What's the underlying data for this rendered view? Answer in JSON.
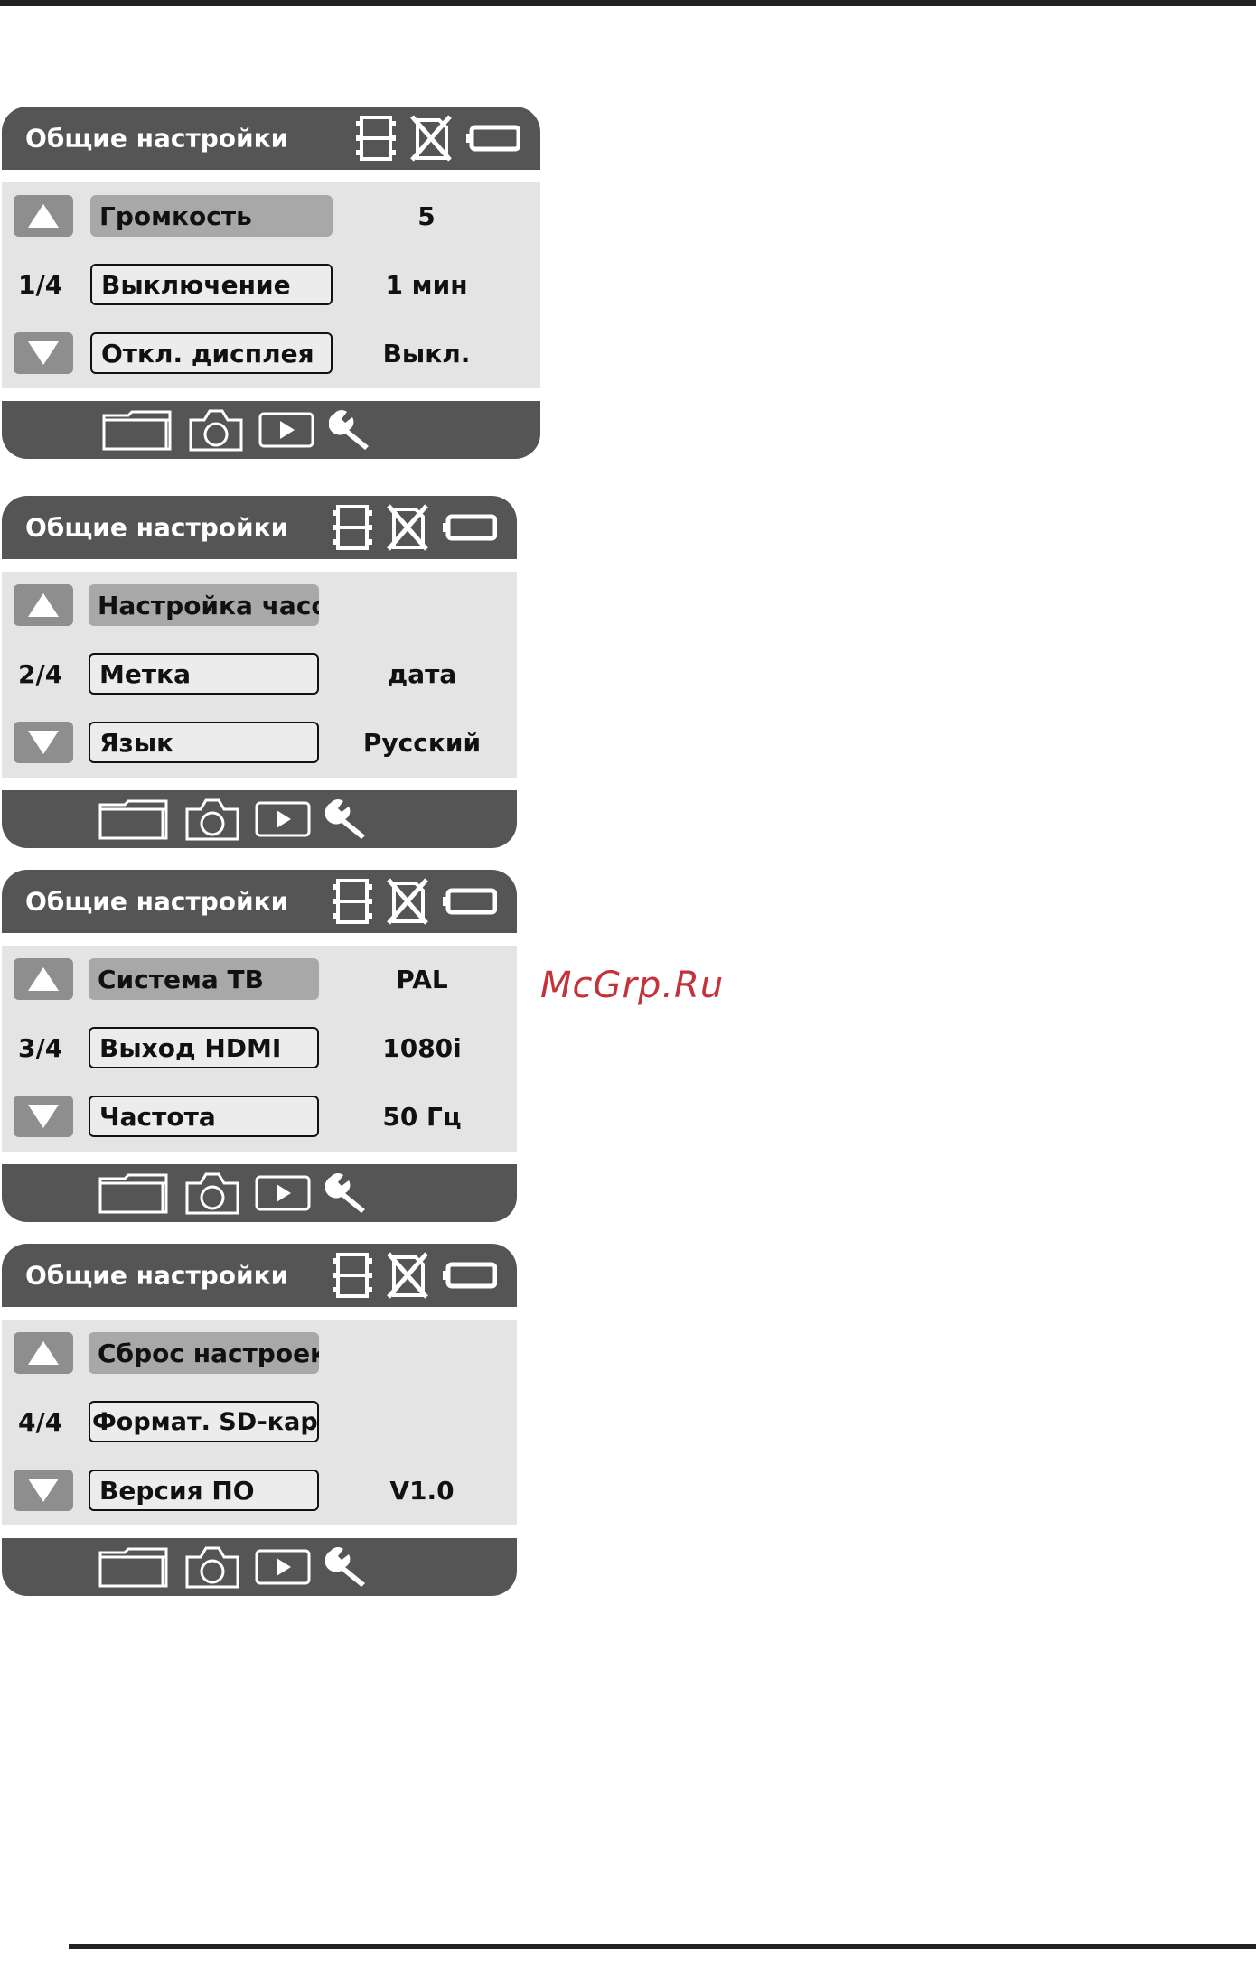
{
  "watermark": "McGrp.Ru",
  "screens": [
    {
      "title": "Общие настройки",
      "page": "1/4",
      "items": [
        {
          "label": "Громкость",
          "value": "5",
          "selected": true
        },
        {
          "label": "Выключение",
          "value": "1 мин",
          "selected": false
        },
        {
          "label": "Откл. дисплея",
          "value": "Выкл.",
          "selected": false
        }
      ]
    },
    {
      "title": "Общие настройки",
      "page": "2/4",
      "items": [
        {
          "label": "Настройка часов",
          "value": "",
          "selected": true
        },
        {
          "label": "Метка",
          "value": "дата",
          "selected": false
        },
        {
          "label": "Язык",
          "value": "Русский",
          "selected": false
        }
      ]
    },
    {
      "title": "Общие настройки",
      "page": "3/4",
      "items": [
        {
          "label": "Система ТВ",
          "value": "PAL",
          "selected": true
        },
        {
          "label": "Выход HDMI",
          "value": "1080i",
          "selected": false
        },
        {
          "label": "Частота",
          "value": "50 Гц",
          "selected": false
        }
      ]
    },
    {
      "title": "Общие настройки",
      "page": "4/4",
      "items": [
        {
          "label": "Сброс настроек",
          "value": "",
          "selected": true
        },
        {
          "label": "Формат. SD-карту",
          "value": "",
          "selected": false
        },
        {
          "label": "Версия ПО",
          "value": "V1.0",
          "selected": false
        }
      ]
    }
  ],
  "icons": {
    "header": [
      "film-icon",
      "no-card-icon",
      "battery-icon"
    ],
    "footer": [
      "folder-icon",
      "camera-icon",
      "play-icon",
      "wrench-icon"
    ],
    "up": "up-arrow-icon",
    "down": "down-arrow-icon"
  },
  "colors": {
    "bar": "#555555",
    "panel": "#e4e4e4",
    "selected": "#a8a8a8",
    "arrow_button": "#8e8e8e",
    "watermark": "#c4333b"
  }
}
